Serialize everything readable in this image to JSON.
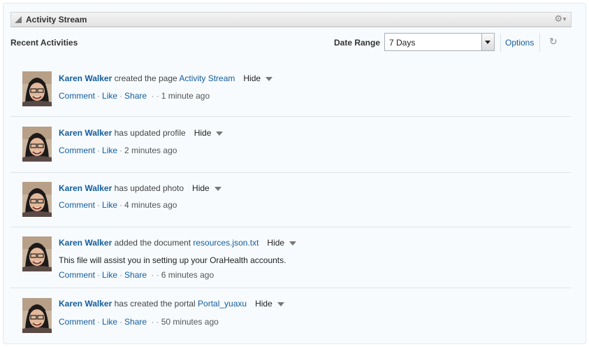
{
  "panel": {
    "title": "Activity Stream",
    "recent_label": "Recent Activities",
    "date_range_label": "Date Range",
    "date_range_value": "7 Days",
    "options_label": "Options"
  },
  "activities": [
    {
      "name": "Karen Walker",
      "verb": "created the page",
      "object": "Activity Stream",
      "hide": "Hide",
      "actions": [
        "Comment",
        "Like",
        "Share"
      ],
      "extra_sep": true,
      "time": "1 minute ago",
      "desc": ""
    },
    {
      "name": "Karen Walker",
      "verb": "has updated profile",
      "object": "",
      "hide": "Hide",
      "actions": [
        "Comment",
        "Like"
      ],
      "extra_sep": false,
      "time": "2 minutes ago",
      "desc": ""
    },
    {
      "name": "Karen Walker",
      "verb": "has updated photo",
      "object": "",
      "hide": "Hide",
      "actions": [
        "Comment",
        "Like"
      ],
      "extra_sep": false,
      "time": "4 minutes ago",
      "desc": ""
    },
    {
      "name": "Karen Walker",
      "verb": "added the document",
      "object": "resources.json.txt",
      "hide": "Hide",
      "actions": [
        "Comment",
        "Like",
        "Share"
      ],
      "extra_sep": true,
      "time": "6 minutes ago",
      "desc": "This file will assist you in setting up your OraHealth accounts."
    },
    {
      "name": "Karen Walker",
      "verb": "has created the portal",
      "object": "Portal_yuaxu",
      "hide": "Hide",
      "actions": [
        "Comment",
        "Like",
        "Share"
      ],
      "extra_sep": true,
      "time": "50 minutes ago",
      "desc": ""
    }
  ],
  "colors": {
    "link": "#145c9e",
    "panel_bg": "#f7fbfd"
  }
}
